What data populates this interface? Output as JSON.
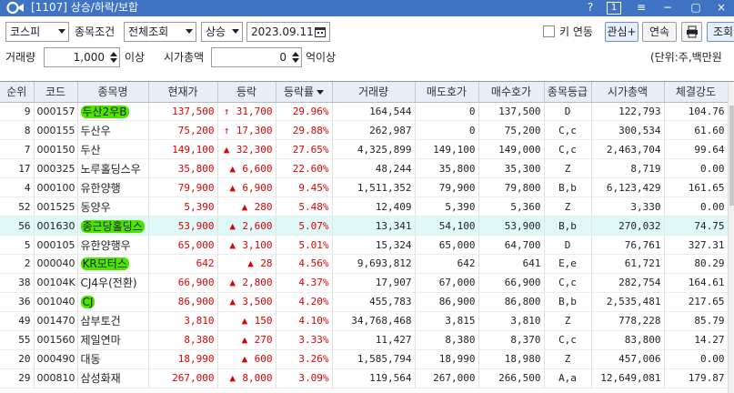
{
  "window": {
    "title": "[1107] 상승/하락/보합",
    "help": "?",
    "page_num": "1",
    "menu_icon": "≡",
    "close": "×"
  },
  "toolbar": {
    "market": "코스피",
    "condition_label": "종목조건",
    "condition_value": "전체조회",
    "direction": "상승",
    "date": "2023.09.11",
    "key_label": "키 연동",
    "interest_button": "관심+",
    "continuous_button": "연속",
    "query_button": "조회",
    "volume_label": "거래량",
    "volume_value": "1,000",
    "volume_suffix": "이상",
    "mcap_label": "시가총액",
    "mcap_value": "0",
    "mcap_suffix": "억이상",
    "unit_label": "(단위:주,백만원"
  },
  "columns": [
    "순위",
    "코드",
    "종목명",
    "현재가",
    "등락",
    "등락률",
    "거래량",
    "매도호가",
    "매수호가",
    "종목등급",
    "시가총액",
    "체결강도"
  ],
  "rows": [
    {
      "rank": "9",
      "code": "000157",
      "name": "두산2우B",
      "price": "137,500",
      "arrow": "↑",
      "change": "31,700",
      "rate": "29.96%",
      "volume": "164,544",
      "ask": "0",
      "bid": "137,500",
      "grade": "D",
      "mcap": "122,793",
      "strength": "104.76",
      "hl": true
    },
    {
      "rank": "8",
      "code": "000155",
      "name": "두산우",
      "price": "75,200",
      "arrow": "↑",
      "change": "17,300",
      "rate": "29.88%",
      "volume": "262,987",
      "ask": "0",
      "bid": "75,200",
      "grade": "C,c",
      "mcap": "300,534",
      "strength": "61.60"
    },
    {
      "rank": "7",
      "code": "000150",
      "name": "두산",
      "price": "149,100",
      "arrow": "▲",
      "change": "32,300",
      "rate": "27.65%",
      "volume": "4,325,899",
      "ask": "149,100",
      "bid": "149,000",
      "grade": "C,c",
      "mcap": "2,463,704",
      "strength": "99.64"
    },
    {
      "rank": "17",
      "code": "000325",
      "name": "노루홀딩스우",
      "price": "35,800",
      "arrow": "▲",
      "change": "6,600",
      "rate": "22.60%",
      "volume": "48,244",
      "ask": "35,800",
      "bid": "35,300",
      "grade": "Z",
      "mcap": "8,719",
      "strength": "0.00"
    },
    {
      "rank": "4",
      "code": "000100",
      "name": "유한양행",
      "price": "79,900",
      "arrow": "▲",
      "change": "6,900",
      "rate": "9.45%",
      "volume": "1,511,352",
      "ask": "79,900",
      "bid": "79,800",
      "grade": "B,b",
      "mcap": "6,123,429",
      "strength": "161.65"
    },
    {
      "rank": "52",
      "code": "001525",
      "name": "동양우",
      "price": "5,390",
      "arrow": "▲",
      "change": "280",
      "rate": "5.48%",
      "volume": "12,409",
      "ask": "5,390",
      "bid": "5,360",
      "grade": "Z",
      "mcap": "3,330",
      "strength": "0.00"
    },
    {
      "rank": "56",
      "code": "001630",
      "name": "종근당홀딩스",
      "price": "53,900",
      "arrow": "▲",
      "change": "2,600",
      "rate": "5.07%",
      "volume": "13,341",
      "ask": "54,100",
      "bid": "53,900",
      "grade": "B,b",
      "mcap": "270,032",
      "strength": "74.75",
      "hl": true,
      "sel": true
    },
    {
      "rank": "5",
      "code": "000105",
      "name": "유한양행우",
      "price": "65,000",
      "arrow": "▲",
      "change": "3,100",
      "rate": "5.01%",
      "volume": "15,324",
      "ask": "65,000",
      "bid": "64,700",
      "grade": "D",
      "mcap": "76,761",
      "strength": "327.31"
    },
    {
      "rank": "2",
      "code": "000040",
      "name": "KR모터스",
      "price": "642",
      "arrow": "▲",
      "change": "28",
      "rate": "4.56%",
      "volume": "9,693,812",
      "ask": "642",
      "bid": "641",
      "grade": "E,e",
      "mcap": "61,721",
      "strength": "80.29",
      "hl": true
    },
    {
      "rank": "38",
      "code": "00104K",
      "name": "CJ4우(전환)",
      "price": "66,900",
      "arrow": "▲",
      "change": "2,800",
      "rate": "4.37%",
      "volume": "17,907",
      "ask": "67,000",
      "bid": "66,900",
      "grade": "C,c",
      "mcap": "282,754",
      "strength": "164.61"
    },
    {
      "rank": "36",
      "code": "001040",
      "name": "CJ",
      "price": "86,900",
      "arrow": "▲",
      "change": "3,500",
      "rate": "4.20%",
      "volume": "455,783",
      "ask": "86,900",
      "bid": "86,800",
      "grade": "B,b",
      "mcap": "2,535,481",
      "strength": "217.65",
      "hl": true
    },
    {
      "rank": "49",
      "code": "001470",
      "name": "삼부토건",
      "price": "3,810",
      "arrow": "▲",
      "change": "150",
      "rate": "4.10%",
      "volume": "34,768,468",
      "ask": "3,815",
      "bid": "3,810",
      "grade": "Z",
      "mcap": "778,228",
      "strength": "85.79"
    },
    {
      "rank": "55",
      "code": "001560",
      "name": "제일연마",
      "price": "8,380",
      "arrow": "▲",
      "change": "270",
      "rate": "3.33%",
      "volume": "11,427",
      "ask": "8,380",
      "bid": "8,370",
      "grade": "C,c",
      "mcap": "83,800",
      "strength": "14.27"
    },
    {
      "rank": "20",
      "code": "000490",
      "name": "대동",
      "price": "18,990",
      "arrow": "▲",
      "change": "600",
      "rate": "3.26%",
      "volume": "1,585,794",
      "ask": "18,990",
      "bid": "18,980",
      "grade": "Z",
      "mcap": "457,006",
      "strength": "0.00"
    },
    {
      "rank": "29",
      "code": "000810",
      "name": "삼성화재",
      "price": "267,000",
      "arrow": "▲",
      "change": "8,000",
      "rate": "3.09%",
      "volume": "119,564",
      "ask": "267,000",
      "bid": "266,500",
      "grade": "A,a",
      "mcap": "12,649,081",
      "strength": "179.87"
    }
  ],
  "colors": {
    "title_bar": "#3f74c4",
    "up_red": "#e00000",
    "highlight": "#4ce600",
    "selected_row": "#dff8f8",
    "header": "#e8eef7"
  }
}
